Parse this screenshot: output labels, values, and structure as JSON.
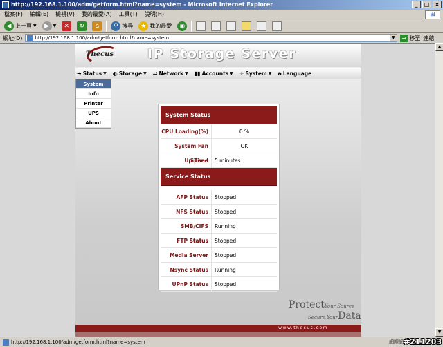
{
  "window": {
    "title": "http://192.168.1.100/adm/getform.html?name=system - Microsoft Internet Explorer",
    "min": "_",
    "max": "□",
    "close": "×"
  },
  "menubar": [
    "檔案(F)",
    "編輯(E)",
    "檢視(V)",
    "我的最愛(A)",
    "工具(T)",
    "說明(H)"
  ],
  "toolbar": {
    "back": "上一頁",
    "search": "搜尋",
    "favorites": "我的最愛"
  },
  "address": {
    "label": "網址(D)",
    "url": "http://192.168.1.100/adm/getform.html?name=system",
    "go": "移至",
    "links": "連結"
  },
  "banner": {
    "logo": "Thecus",
    "title": "IP Storage Server"
  },
  "nav": [
    "Status",
    "Storage",
    "Network",
    "Accounts",
    "System",
    "Language"
  ],
  "submenu": [
    "System",
    "Info",
    "Printer",
    "UPS",
    "About"
  ],
  "system_status": {
    "title": "System Status",
    "rows": [
      {
        "label": "CPU Loading(%)",
        "value": "0  %"
      },
      {
        "label": "System Fan Speed",
        "value": "OK"
      },
      {
        "label": "Up Time",
        "value": "5 minutes"
      }
    ]
  },
  "service_status": {
    "title": "Service Status",
    "rows": [
      {
        "label": "AFP Status",
        "value": "Stopped"
      },
      {
        "label": "NFS Status",
        "value": "Stopped"
      },
      {
        "label": "SMB/CIFS Status",
        "value": "Running"
      },
      {
        "label": "FTP Status",
        "value": "Stopped"
      },
      {
        "label": "Media Server",
        "value": "Stopped"
      },
      {
        "label": "Nsync Status",
        "value": "Running"
      },
      {
        "label": "UPnP Status",
        "value": "Stopped"
      }
    ]
  },
  "footer": {
    "protect": "Protect",
    "your_source": "Your Source",
    "secure": "Secure Your",
    "data": "Data",
    "url": "www.thecus.com"
  },
  "statusbar": {
    "url": "http://192.168.1.100/adm/getform.html?name=system",
    "zone": "網際網路",
    "stamp": "#211203"
  }
}
